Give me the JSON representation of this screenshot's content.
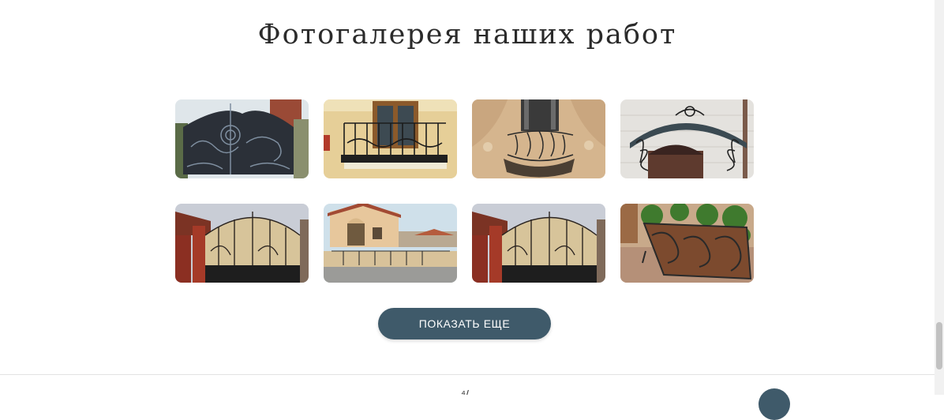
{
  "section": {
    "title": "Фотогалерея наших работ"
  },
  "gallery": {
    "photos": [
      {
        "name": "wrought-iron-gate-ornate"
      },
      {
        "name": "balcony-railing"
      },
      {
        "name": "art-nouveau-balcony"
      },
      {
        "name": "entrance-canopy"
      },
      {
        "name": "red-brick-gate"
      },
      {
        "name": "villa-fence"
      },
      {
        "name": "red-brick-gate-duplicate"
      },
      {
        "name": "flower-planter-forged"
      }
    ]
  },
  "actions": {
    "show_more_label": "ПОКАЗАТЬ ЕЩЕ"
  },
  "colors": {
    "button_bg": "#3f5a6a",
    "button_text": "#ffffff",
    "title_text": "#2b2b2b"
  }
}
